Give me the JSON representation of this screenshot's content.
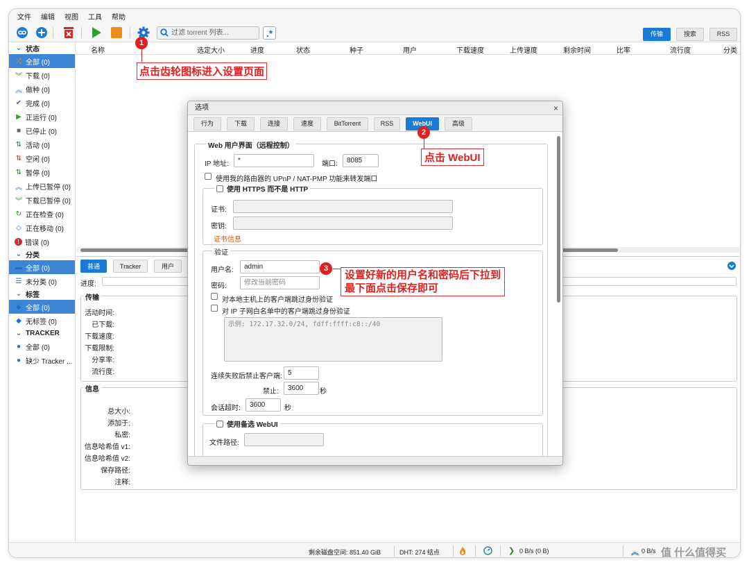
{
  "menu": [
    "文件",
    "编辑",
    "视图",
    "工具",
    "帮助"
  ],
  "toolbar": {
    "search_placeholder": "过滤 torrent 列表...",
    "regex_label": ".*",
    "right_tabs": [
      "传输",
      "搜索",
      "RSS"
    ]
  },
  "sidebar": {
    "status_header": "状态",
    "status_items": [
      {
        "label": "全部 (0)",
        "icon": "shuffle-icon",
        "color": "#e58a2c"
      },
      {
        "label": "下载 (0)",
        "icon": "download-icon",
        "color": "#2a8a2a"
      },
      {
        "label": "做种 (0)",
        "icon": "seed-icon",
        "color": "#3a7ad0"
      },
      {
        "label": "完成 (0)",
        "icon": "check-icon",
        "color": "#6a4ad0"
      },
      {
        "label": "正运行 (0)",
        "icon": "play-icon",
        "color": "#2aa52a"
      },
      {
        "label": "已停止 (0)",
        "icon": "stop-icon",
        "color": "#666666"
      },
      {
        "label": "活动 (0)",
        "icon": "updown-icon",
        "color": "#2a7a2a"
      },
      {
        "label": "空闲 (0)",
        "icon": "updown-icon",
        "color": "#d02a2a"
      },
      {
        "label": "暂停 (0)",
        "icon": "updown-icon",
        "color": "#2a7a2a"
      },
      {
        "label": "上传已暂停 (0)",
        "icon": "upload-paused-icon",
        "color": "#3a7ad0"
      },
      {
        "label": "下载已暂停 (0)",
        "icon": "download-paused-icon",
        "color": "#2a8a2a"
      },
      {
        "label": "正在检查 (0)",
        "icon": "refresh-icon",
        "color": "#2a8a2a"
      },
      {
        "label": "正在移动 (0)",
        "icon": "move-icon",
        "color": "#3a7ad0"
      },
      {
        "label": "错误 (0)",
        "icon": "error-icon",
        "color": "#d02a2a"
      }
    ],
    "category_header": "分类",
    "category_items": [
      {
        "label": "全部 (0)",
        "icon": "folder-icon"
      },
      {
        "label": "未分类 (0)",
        "icon": "list-icon"
      }
    ],
    "tag_header": "标签",
    "tag_items": [
      {
        "label": "全部 (0)",
        "icon": "tag-icon"
      },
      {
        "label": "无标签 (0)",
        "icon": "tag-icon"
      }
    ],
    "tracker_header": "TRACKER",
    "tracker_items": [
      {
        "label": "全部 (0)",
        "icon": "pin-icon"
      },
      {
        "label": "缺少 Tracker ...",
        "icon": "pin-icon"
      }
    ]
  },
  "table_headers": [
    "名称",
    "选定大小",
    "进度",
    "状态",
    "种子",
    "用户",
    "下载速度",
    "上传速度",
    "剩余时间",
    "比率",
    "流行度",
    "分类"
  ],
  "props": {
    "tabs": [
      "普通",
      "Tracker",
      "用户"
    ],
    "progress_label": "进度:",
    "transfer_legend": "传输",
    "transfer_rows": [
      "活动时间:",
      "已下载:",
      "下载速度:",
      "下载限制:",
      "分享率:",
      "流行度:"
    ],
    "info_legend": "信息",
    "info_rows": [
      "总大小:",
      "添加于:",
      "私密:",
      "信息哈希值 v1:",
      "信息哈希值 v2:",
      "保存路径:",
      "注释:"
    ]
  },
  "statusbar": {
    "disk": "剩余磁盘空间: 851.40 GiB",
    "dht": "DHT: 274 结点",
    "down": "0 B/s (0 B)",
    "up": "0 B/s"
  },
  "dialog": {
    "title": "选项",
    "close": "×",
    "tabs": [
      "行为",
      "下载",
      "连接",
      "速度",
      "BitTorrent",
      "RSS",
      "WebUI",
      "高级"
    ],
    "active_tab": "WebUI",
    "webui_legend": "Web 用户界面（远程控制）",
    "ip_label": "IP 地址:",
    "ip_value": "*",
    "port_label": "端口:",
    "port_value": "8085",
    "upnp_label": "使用我的路由器的 UPnP / NAT-PMP 功能来转发端口",
    "https_legend": "使用 HTTPS 而不是 HTTP",
    "cert_label": "证书:",
    "key_label": "密钥:",
    "cert_info": "证书信息",
    "auth_legend": "验证",
    "user_label": "用户名:",
    "user_value": "admin",
    "pass_label": "密码:",
    "pass_placeholder": "修改当前密码",
    "bypass_local": "对本地主机上的客户端跳过身份验证",
    "bypass_whitelist": "对 IP 子网白名单中的客户端跳过身份验证",
    "whitelist_placeholder": "示例: 172.17.32.0/24, fdff:ffff:c8::/40",
    "ban_label": "连续失败后禁止客户端:",
    "ban_value": "5",
    "banfor_label": "禁止:",
    "banfor_value": "3600",
    "banfor_unit": "秒",
    "session_label": "会话超时:",
    "session_value": "3600",
    "session_unit": "秒",
    "alt_legend": "使用备选 WebUI",
    "alt_path_label": "文件路径:"
  },
  "annotations": [
    {
      "num": "1",
      "text": "点击齿轮图标进入设置页面"
    },
    {
      "num": "2",
      "text": "点击 WebUI"
    },
    {
      "num": "3",
      "text": "设置好新的用户名和密码后下拉到\n最下面点击保存即可"
    }
  ],
  "watermark": "值 什么值得买"
}
